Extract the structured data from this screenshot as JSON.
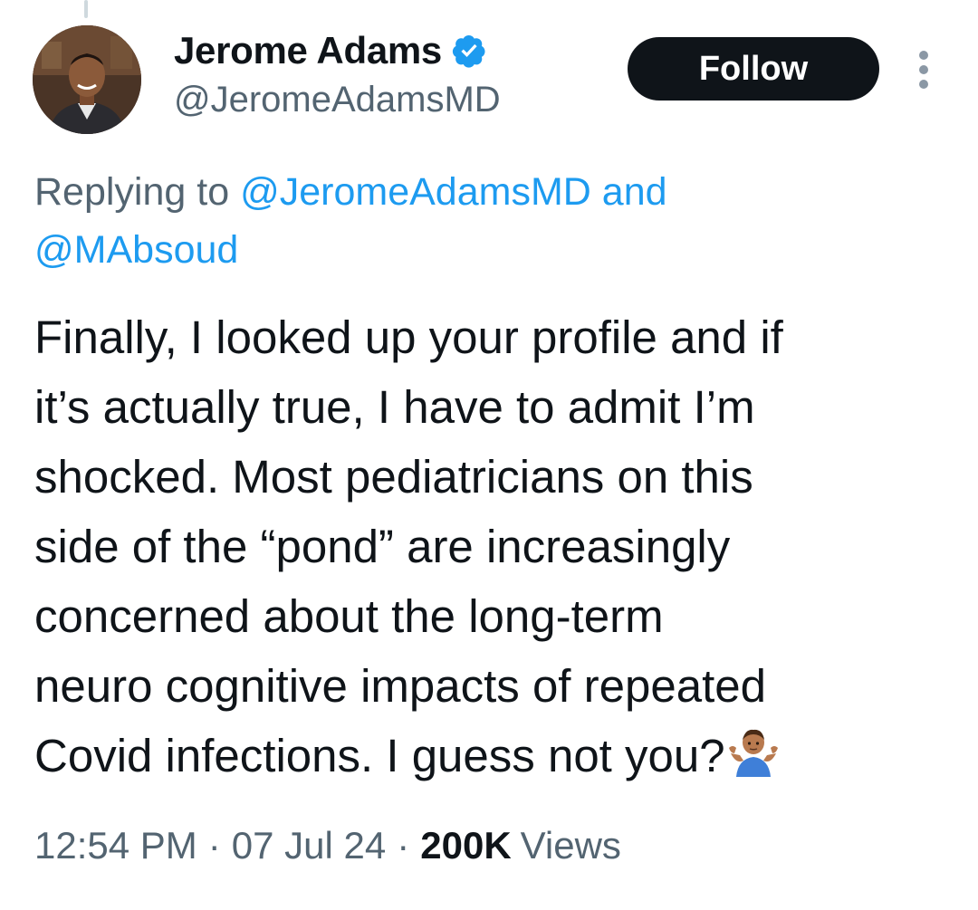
{
  "author": {
    "display_name": "Jerome Adams",
    "handle": "@JeromeAdamsMD",
    "verified": true
  },
  "actions": {
    "follow_label": "Follow",
    "more_icon": "more-vertical-icon"
  },
  "reply_context": {
    "prefix": "Replying to",
    "mention_1": "@JeromeAdamsMD",
    "conjunction": "and",
    "mention_2": "@MAbsoud"
  },
  "tweet": {
    "lines": [
      "Finally, I looked up your profile and if",
      "it’s actually true, I have to admit I’m",
      "shocked. Most pediatricians on this",
      "side of the “pond” are increasingly",
      "concerned about the long-term",
      "neuro cognitive impacts of repeated",
      "Covid infections. I guess not you?"
    ],
    "trailing_emoji": "person-shrugging-emoji"
  },
  "meta": {
    "time": "12:54 PM",
    "separator": "·",
    "date": "07 Jul 24",
    "views_count": "200K",
    "views_label": "Views"
  },
  "colors": {
    "text_primary": "#0f1419",
    "text_secondary": "#536471",
    "link": "#1d9bf0",
    "verified": "#1d9bf0",
    "follow_bg": "#0f1419",
    "follow_text": "#ffffff"
  }
}
